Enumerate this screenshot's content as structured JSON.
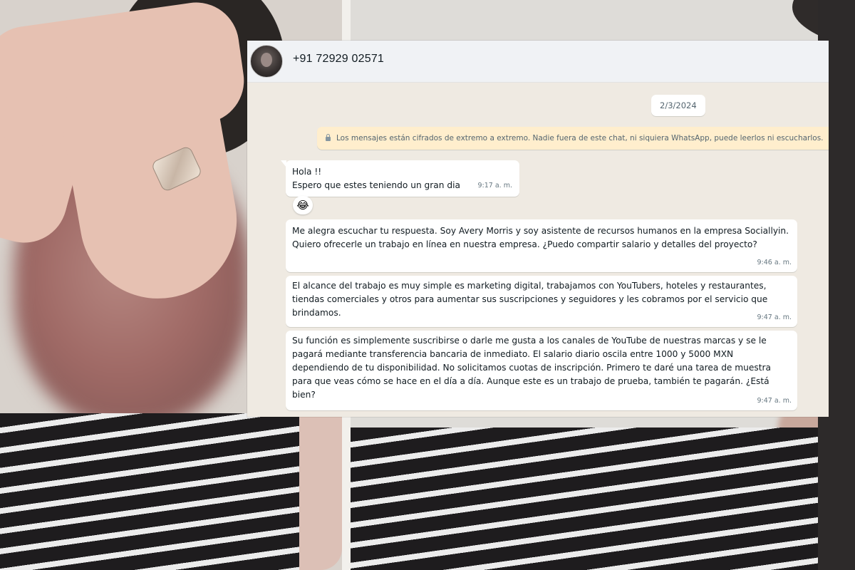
{
  "chat": {
    "contact_name": "+91 72929 02571",
    "date_label": "2/3/2024",
    "encryption_notice": "Los mensajes están cifrados de extremo a extremo. Nadie fuera de este chat, ni siquiera WhatsApp, puede leerlos ni escucharlos.",
    "reaction_emoji": "😂",
    "messages": [
      {
        "text": "Hola !!\nEspero que estes teniendo un gran dia",
        "time": "9:17 a. m."
      },
      {
        "text": "Me alegra escuchar tu respuesta. Soy Avery Morris y soy asistente de recursos humanos en la empresa Sociallyin. Quiero ofrecerle un trabajo en línea en nuestra empresa. ¿Puedo compartir salario y detalles del proyecto?",
        "time": "9:46 a. m."
      },
      {
        "text": "El alcance del trabajo es muy simple es marketing digital, trabajamos con YouTubers, hoteles y restaurantes, tiendas comerciales y otros para aumentar sus suscripciones y seguidores y les cobramos por el servicio que brindamos.",
        "time": "9:47 a. m."
      },
      {
        "text": "Su función es simplemente suscribirse o darle me gusta a los canales de YouTube de nuestras marcas y se le pagará mediante transferencia bancaria de inmediato. El salario diario oscila entre 1000 y 5000 MXN dependiendo de tu disponibilidad. No solicitamos cuotas de inscripción. Primero te daré una tarea de muestra para que veas cómo se hace en el día a día. Aunque este es un trabajo de prueba, también te pagarán. ¿Está bien?",
        "time": "9:47 a. m."
      }
    ]
  }
}
